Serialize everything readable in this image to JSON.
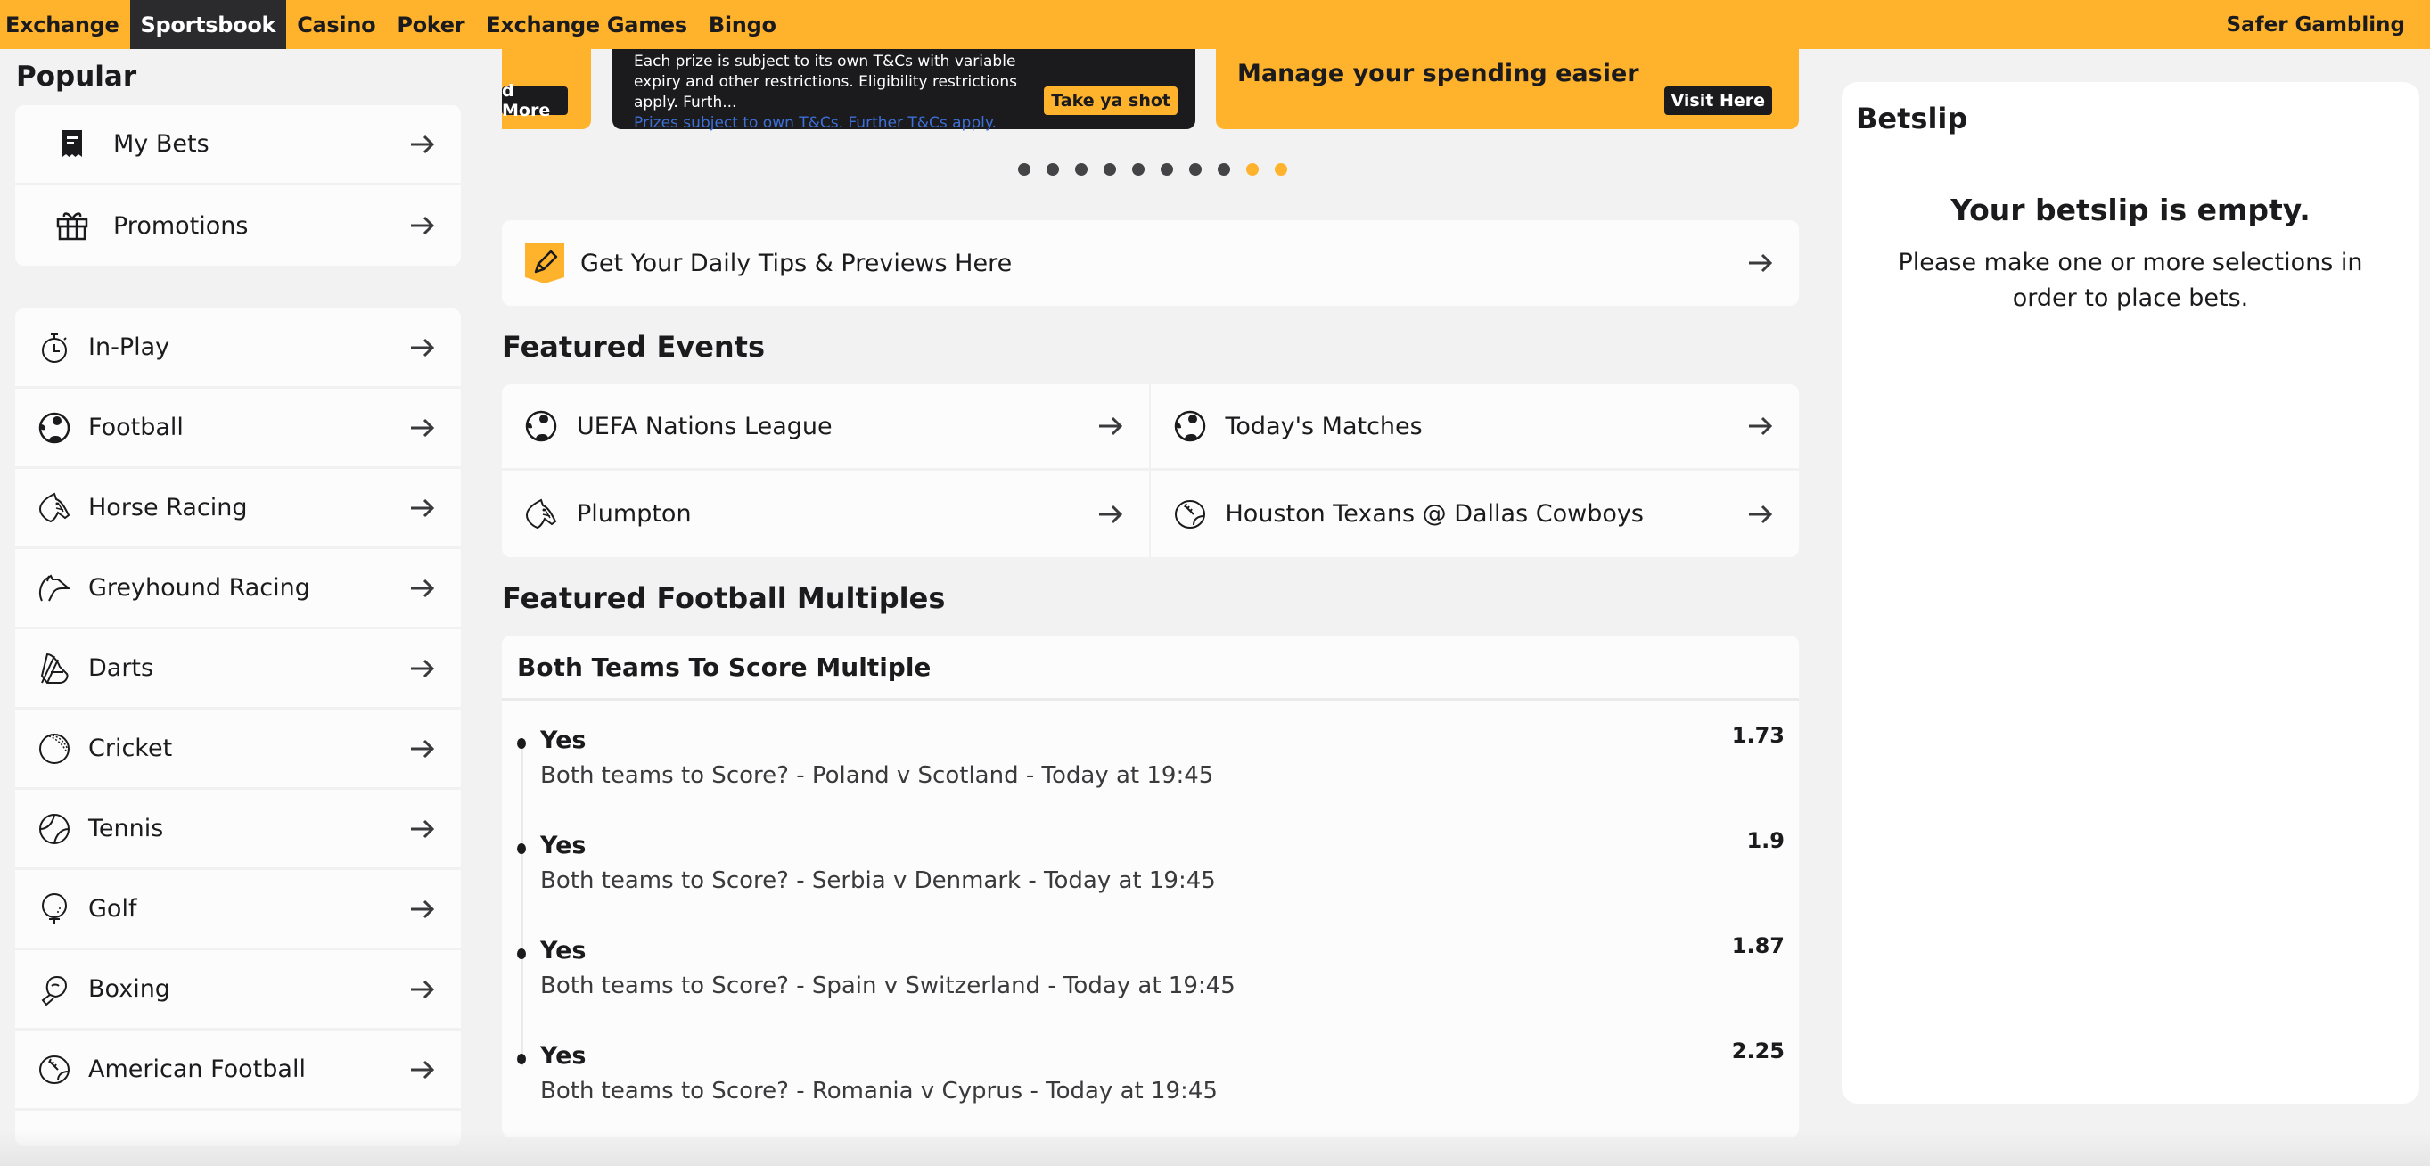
{
  "topbar": {
    "nav": [
      {
        "label": "Exchange",
        "active": false
      },
      {
        "label": "Sportsbook",
        "active": true
      },
      {
        "label": "Casino",
        "active": false
      },
      {
        "label": "Poker",
        "active": false
      },
      {
        "label": "Exchange Games",
        "active": false
      },
      {
        "label": "Bingo",
        "active": false
      }
    ],
    "safer_gambling": "Safer Gambling"
  },
  "sidebar": {
    "popular_title": "Popular",
    "popular": [
      {
        "label": "My Bets",
        "icon": "receipt-icon"
      },
      {
        "label": "Promotions",
        "icon": "gift-icon"
      }
    ],
    "sports": [
      {
        "label": "In-Play",
        "icon": "stopwatch-icon"
      },
      {
        "label": "Football",
        "icon": "football-icon"
      },
      {
        "label": "Horse Racing",
        "icon": "horse-icon"
      },
      {
        "label": "Greyhound Racing",
        "icon": "greyhound-icon"
      },
      {
        "label": "Darts",
        "icon": "darts-icon"
      },
      {
        "label": "Cricket",
        "icon": "cricket-ball-icon"
      },
      {
        "label": "Tennis",
        "icon": "tennis-ball-icon"
      },
      {
        "label": "Golf",
        "icon": "golf-ball-icon"
      },
      {
        "label": "Boxing",
        "icon": "boxing-glove-icon"
      },
      {
        "label": "American Football",
        "icon": "american-football-icon"
      }
    ]
  },
  "banners": {
    "left_button": "d More",
    "middle_text": "Each prize is subject to its own T&Cs with variable expiry and other restrictions. Eligibility restrictions apply. Furth...",
    "middle_link": "Prizes subject to own T&Cs. Further T&Cs apply.",
    "middle_button": "Take ya shot",
    "right_title": "Manage your spending easier",
    "right_button": "Visit Here",
    "dots_total": 10,
    "dots_highlighted": [
      8,
      9
    ]
  },
  "tips": {
    "label": "Get Your Daily Tips & Previews Here",
    "icon": "pencil-icon"
  },
  "featured_events": {
    "title": "Featured Events",
    "items": [
      {
        "label": "UEFA Nations League",
        "icon": "football-icon"
      },
      {
        "label": "Today's Matches",
        "icon": "football-icon"
      },
      {
        "label": "Plumpton",
        "icon": "horse-icon"
      },
      {
        "label": "Houston Texans @ Dallas Cowboys",
        "icon": "american-football-icon"
      }
    ]
  },
  "multiples": {
    "title": "Featured Football Multiples",
    "card_title": "Both Teams To Score Multiple",
    "legs": [
      {
        "selection": "Yes",
        "description": "Both teams to Score? - Poland v Scotland - Today at 19:45",
        "odds": "1.73"
      },
      {
        "selection": "Yes",
        "description": "Both teams to Score? - Serbia v Denmark - Today at 19:45",
        "odds": "1.9"
      },
      {
        "selection": "Yes",
        "description": "Both teams to Score? - Spain v Switzerland - Today at 19:45",
        "odds": "1.87"
      },
      {
        "selection": "Yes",
        "description": "Both teams to Score? - Romania v Cyprus - Today at 19:45",
        "odds": "2.25"
      }
    ]
  },
  "betslip": {
    "title": "Betslip",
    "empty_title": "Your betslip is empty.",
    "empty_message": "Please make one or more selections in order to place bets."
  },
  "colors": {
    "brand": "#ffb32c",
    "dark": "#1b1b1d",
    "link": "#3d6fd6"
  }
}
